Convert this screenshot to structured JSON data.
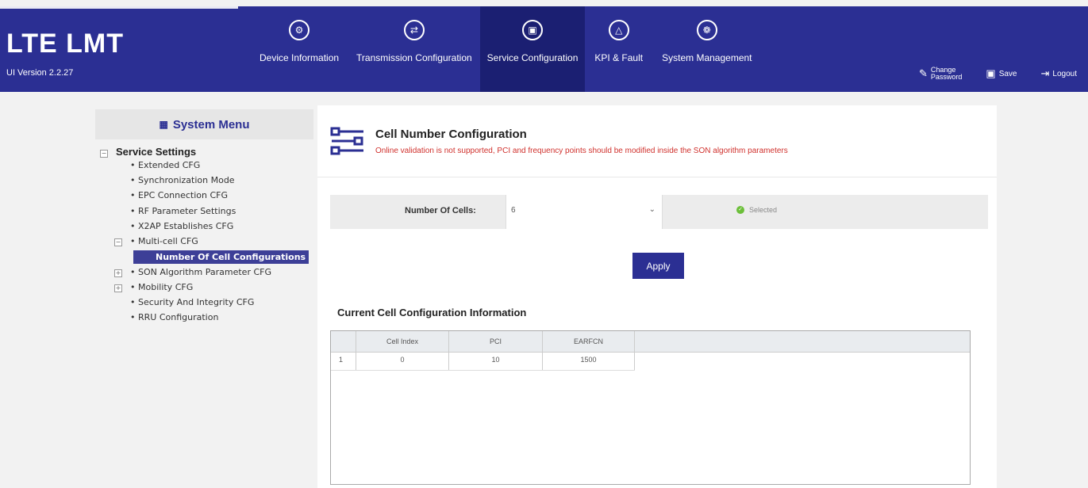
{
  "header": {
    "brand": "LTE LMT",
    "version": "UI Version 2.2.27",
    "nav": [
      {
        "label": "Device Information",
        "icon": "device-info-icon"
      },
      {
        "label": "Transmission Configuration",
        "icon": "transmission-icon"
      },
      {
        "label": "Service Configuration",
        "icon": "service-config-icon"
      },
      {
        "label": "KPI & Fault",
        "icon": "warning-icon"
      },
      {
        "label": "System Management",
        "icon": "gear-icon"
      }
    ],
    "active_nav": "Service Configuration",
    "actions": {
      "change_password_line1": "Change",
      "change_password_line2": "Password",
      "save": "Save",
      "logout": "Logout"
    }
  },
  "sidebar": {
    "title": "System Menu",
    "root": "Service Settings",
    "items": [
      "Extended CFG",
      "Synchronization Mode",
      "EPC Connection CFG",
      "RF Parameter Settings",
      "X2AP Establishes CFG",
      "Multi-cell CFG",
      "Number Of Cell Configurations",
      "SON Algorithm Parameter CFG",
      "Mobility CFG",
      "Security And Integrity CFG",
      "RRU Configuration"
    ],
    "selected": "Number Of Cell Configurations"
  },
  "main": {
    "title": "Cell Number Configuration",
    "warning": "Online validation is not supported, PCI and frequency points should be modified inside the SON algorithm parameters",
    "form": {
      "label": "Number Of Cells:",
      "value": "6",
      "status": "Selected"
    },
    "apply_label": "Apply",
    "section_title": "Current Cell Configuration Information",
    "table": {
      "headers": [
        "",
        "Cell Index",
        "PCI",
        "EARFCN"
      ],
      "rows": [
        [
          "1",
          "0",
          "10",
          "1500"
        ]
      ]
    }
  },
  "colors": {
    "header_bg": "#2b2f93",
    "active_nav_bg": "#1b1f72",
    "warning": "#d0312d",
    "selected_item": "#3d3f97",
    "status_ok": "#6cbf3a"
  }
}
